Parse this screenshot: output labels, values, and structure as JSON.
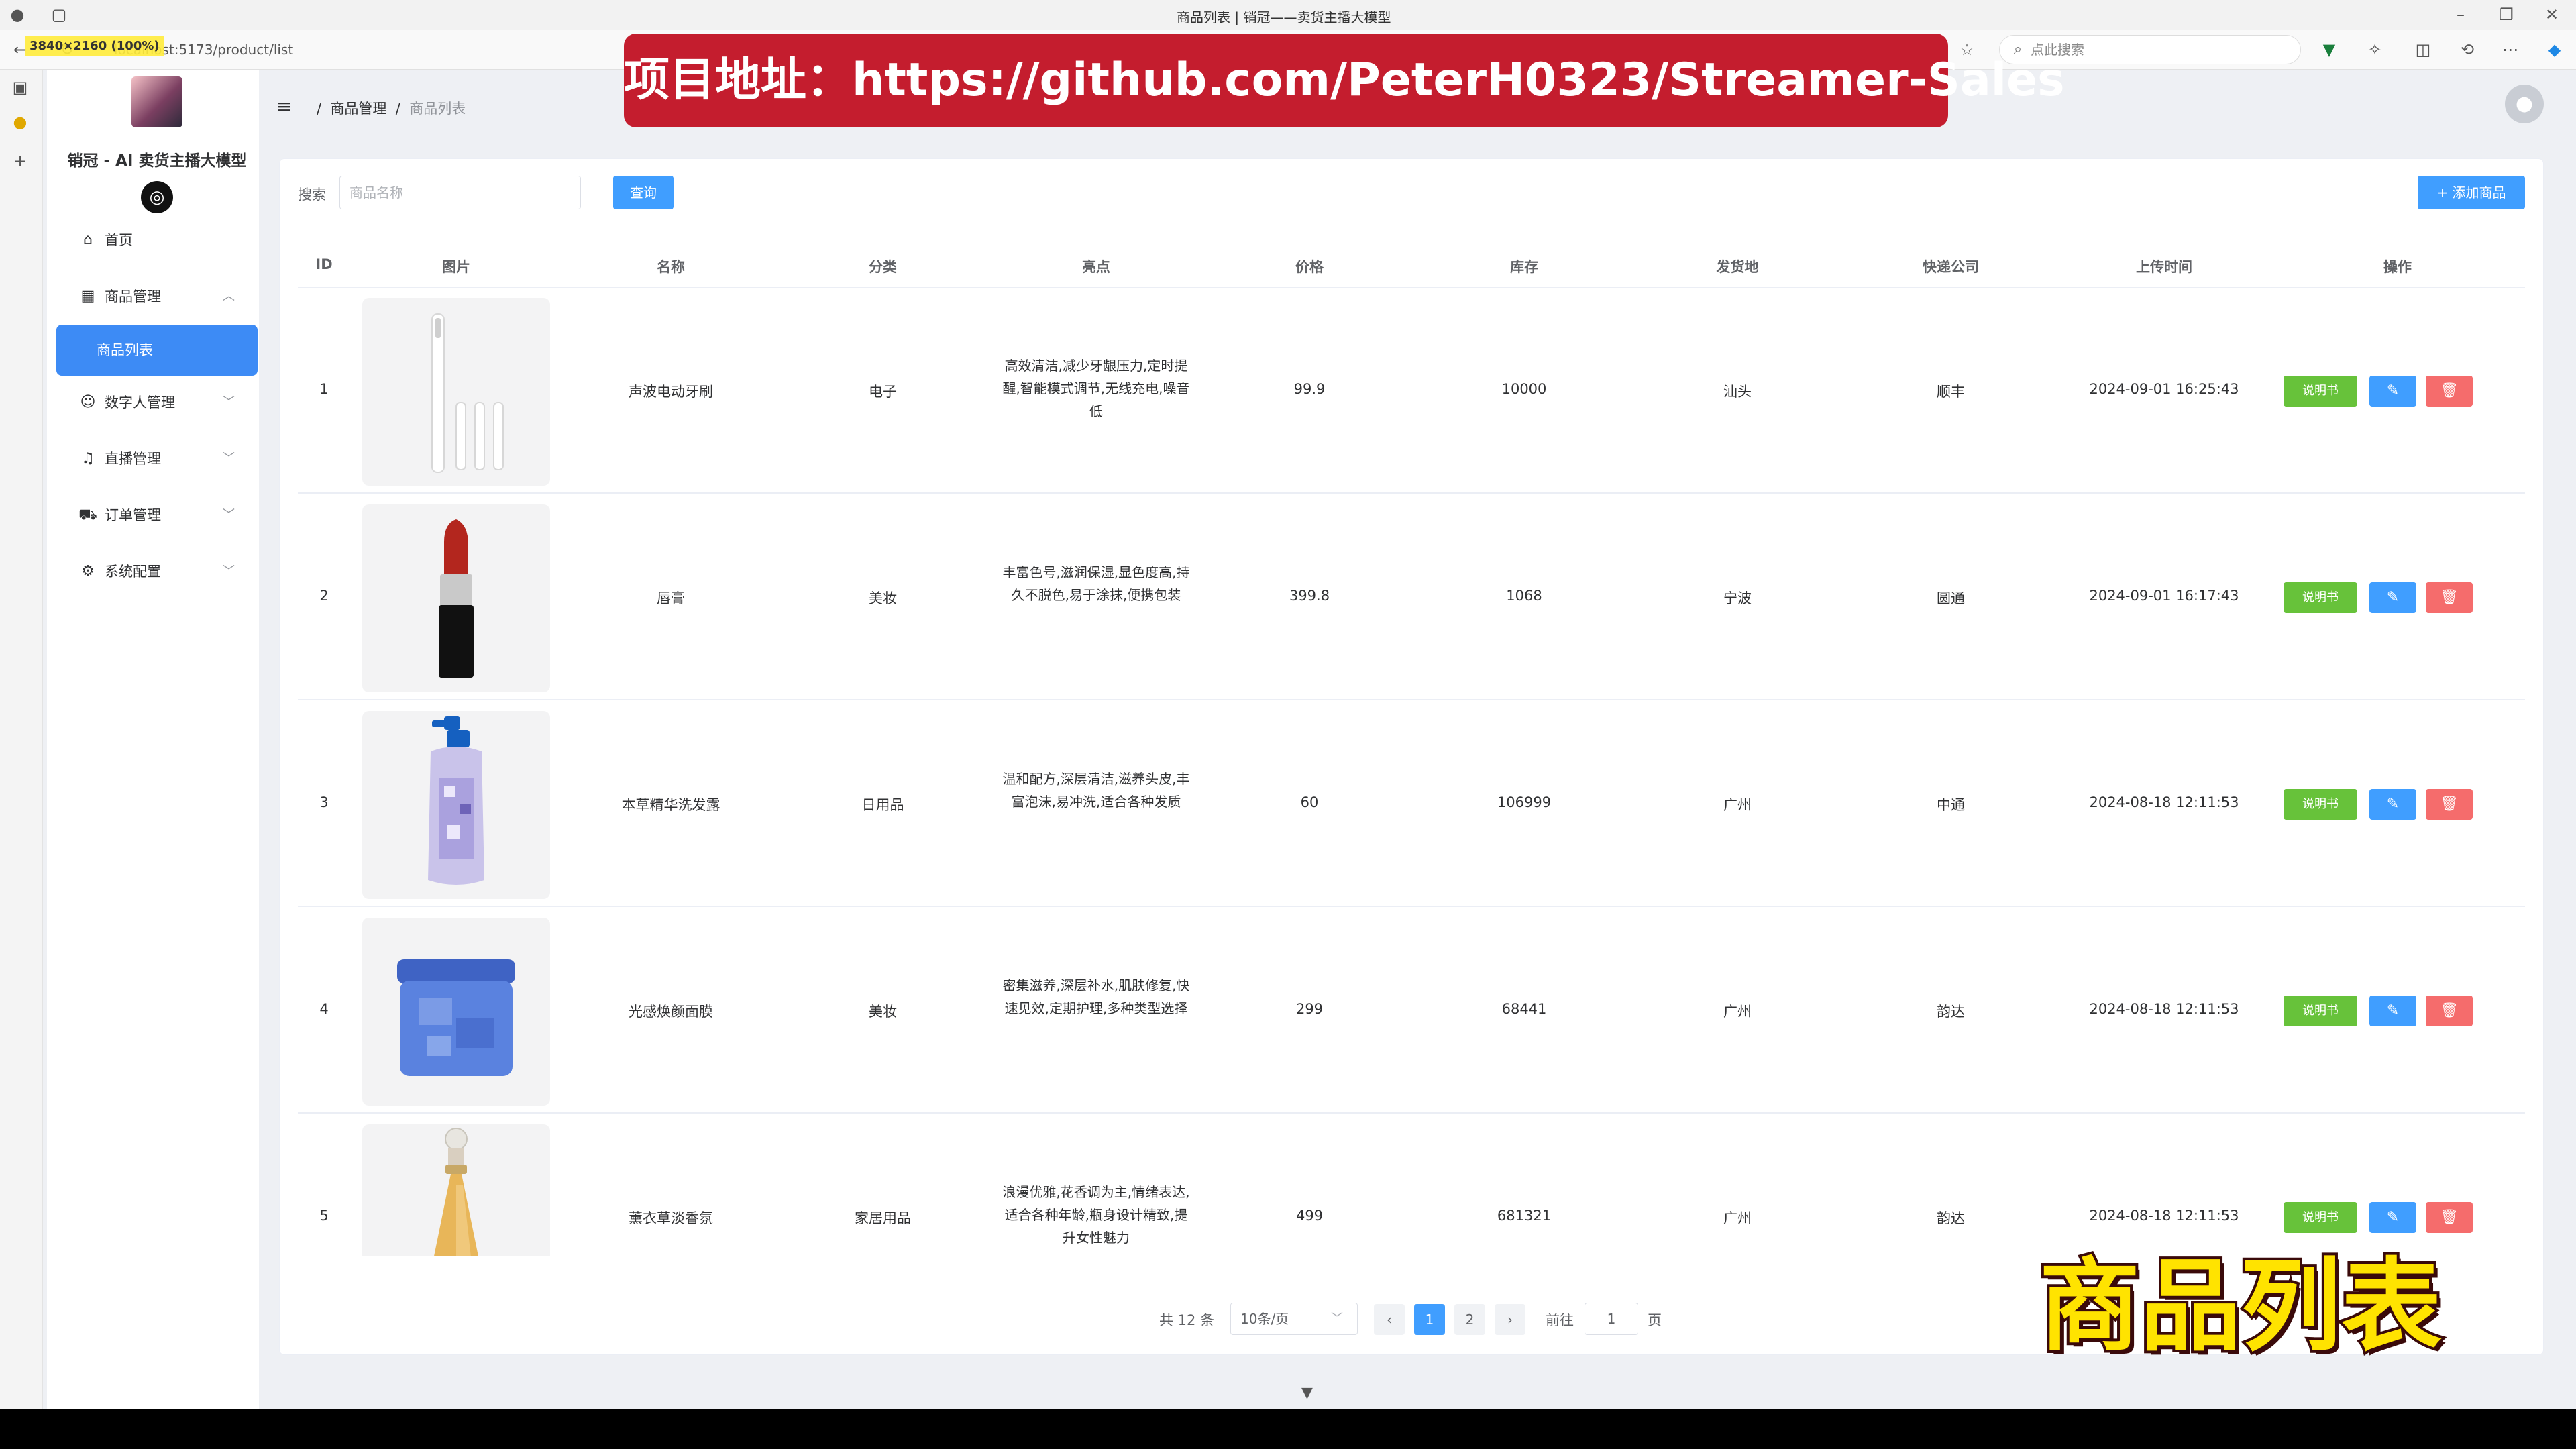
{
  "browser": {
    "tab_title": "商品列表 | 销冠——卖货主播大模型",
    "url": "localhost:5173/product/list",
    "search_placeholder": "点此搜索",
    "resolution_badge": "3840×2160 (100%)"
  },
  "sidebar": {
    "app_title": "销冠 - AI 卖货主播大模型",
    "items": [
      {
        "label": "首页",
        "icon": "home-icon"
      },
      {
        "label": "商品管理",
        "icon": "grid-icon",
        "expanded": true
      },
      {
        "label": "商品列表",
        "active": true
      },
      {
        "label": "数字人管理",
        "icon": "user-icon"
      },
      {
        "label": "直播管理",
        "icon": "mic-icon"
      },
      {
        "label": "订单管理",
        "icon": "cart-icon"
      },
      {
        "label": "系统配置",
        "icon": "gear-icon"
      }
    ]
  },
  "header": {
    "breadcrumb": [
      "商品管理",
      "商品列表"
    ]
  },
  "toolbar": {
    "search_label": "搜索",
    "search_placeholder": "商品名称",
    "query_label": "查询",
    "add_label": "+ 添加商品"
  },
  "table": {
    "columns": [
      "ID",
      "图片",
      "名称",
      "分类",
      "亮点",
      "价格",
      "库存",
      "发货地",
      "快递公司",
      "上传时间",
      "操作"
    ],
    "rows": [
      {
        "id": "1",
        "name": "声波电动牙刷",
        "category": "电子",
        "highlight": "高效清洁,减少牙龈压力,定时提醒,智能模式调节,无线充电,噪音低",
        "price": "99.9",
        "stock": "10000",
        "origin": "汕头",
        "courier": "顺丰",
        "time": "2024-09-01 16:25:43"
      },
      {
        "id": "2",
        "name": "唇膏",
        "category": "美妆",
        "highlight": "丰富色号,滋润保湿,显色度高,持久不脱色,易于涂抹,便携包装",
        "price": "399.8",
        "stock": "1068",
        "origin": "宁波",
        "courier": "圆通",
        "time": "2024-09-01 16:17:43"
      },
      {
        "id": "3",
        "name": "本草精华洗发露",
        "category": "日用品",
        "highlight": "温和配方,深层清洁,滋养头皮,丰富泡沫,易冲洗,适合各种发质",
        "price": "60",
        "stock": "106999",
        "origin": "广州",
        "courier": "中通",
        "time": "2024-08-18 12:11:53"
      },
      {
        "id": "4",
        "name": "光感焕颜面膜",
        "category": "美妆",
        "highlight": "密集滋养,深层补水,肌肤修复,快速见效,定期护理,多种类型选择",
        "price": "299",
        "stock": "68441",
        "origin": "广州",
        "courier": "韵达",
        "time": "2024-08-18 12:11:53"
      },
      {
        "id": "5",
        "name": "薰衣草淡香氛",
        "category": "家居用品",
        "highlight": "浪漫优雅,花香调为主,情绪表达,适合各种年龄,瓶身设计精致,提升女性魅力",
        "price": "499",
        "stock": "681321",
        "origin": "广州",
        "courier": "韵达",
        "time": "2024-08-18 12:11:53"
      }
    ],
    "manual_label": "说明书",
    "edit_icon": "edit-icon",
    "delete_icon": "trash-icon"
  },
  "pagination": {
    "total": "共 12 条",
    "page_size": "10条/页",
    "pages": [
      "1",
      "2"
    ],
    "current": "1",
    "goto_label": "前往",
    "goto_value": "1",
    "page_suffix": "页"
  },
  "overlay": {
    "banner": "项目地址：https://github.com/PeterH0323/Streamer-Sales",
    "stamp": "商品列表"
  },
  "colors": {
    "primary": "#409eff",
    "success": "#67c23a",
    "danger": "#f56c6c",
    "banner_bg": "#c41d2e",
    "stamp_fill": "#ffe300"
  }
}
